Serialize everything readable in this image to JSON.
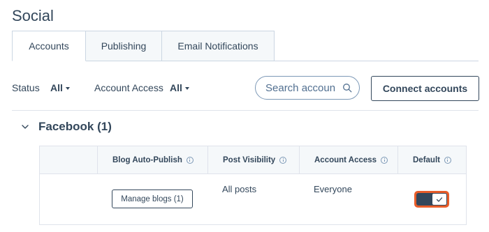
{
  "page": {
    "title": "Social"
  },
  "tabs": [
    {
      "label": "Accounts",
      "active": true
    },
    {
      "label": "Publishing",
      "active": false
    },
    {
      "label": "Email Notifications",
      "active": false
    }
  ],
  "filters": {
    "status_label": "Status",
    "status_value": "All",
    "access_label": "Account Access",
    "access_value": "All"
  },
  "search": {
    "placeholder": "Search accoun"
  },
  "connect_button": {
    "label": "Connect accounts"
  },
  "section": {
    "title": "Facebook (1)"
  },
  "table": {
    "columns": [
      "Blog Auto-Publish",
      "Post Visibility",
      "Account Access",
      "Default"
    ],
    "row": {
      "manage_label": "Manage blogs (1)",
      "visibility": "All posts",
      "access": "Everyone",
      "default_on": true
    }
  },
  "colors": {
    "accent": "#e85d2a",
    "text": "#33475b",
    "border": "#cbd6e2"
  },
  "icons": [
    "search-icon",
    "chevron-down-icon",
    "info-icon",
    "checkmark-icon",
    "caret-down-icon"
  ]
}
